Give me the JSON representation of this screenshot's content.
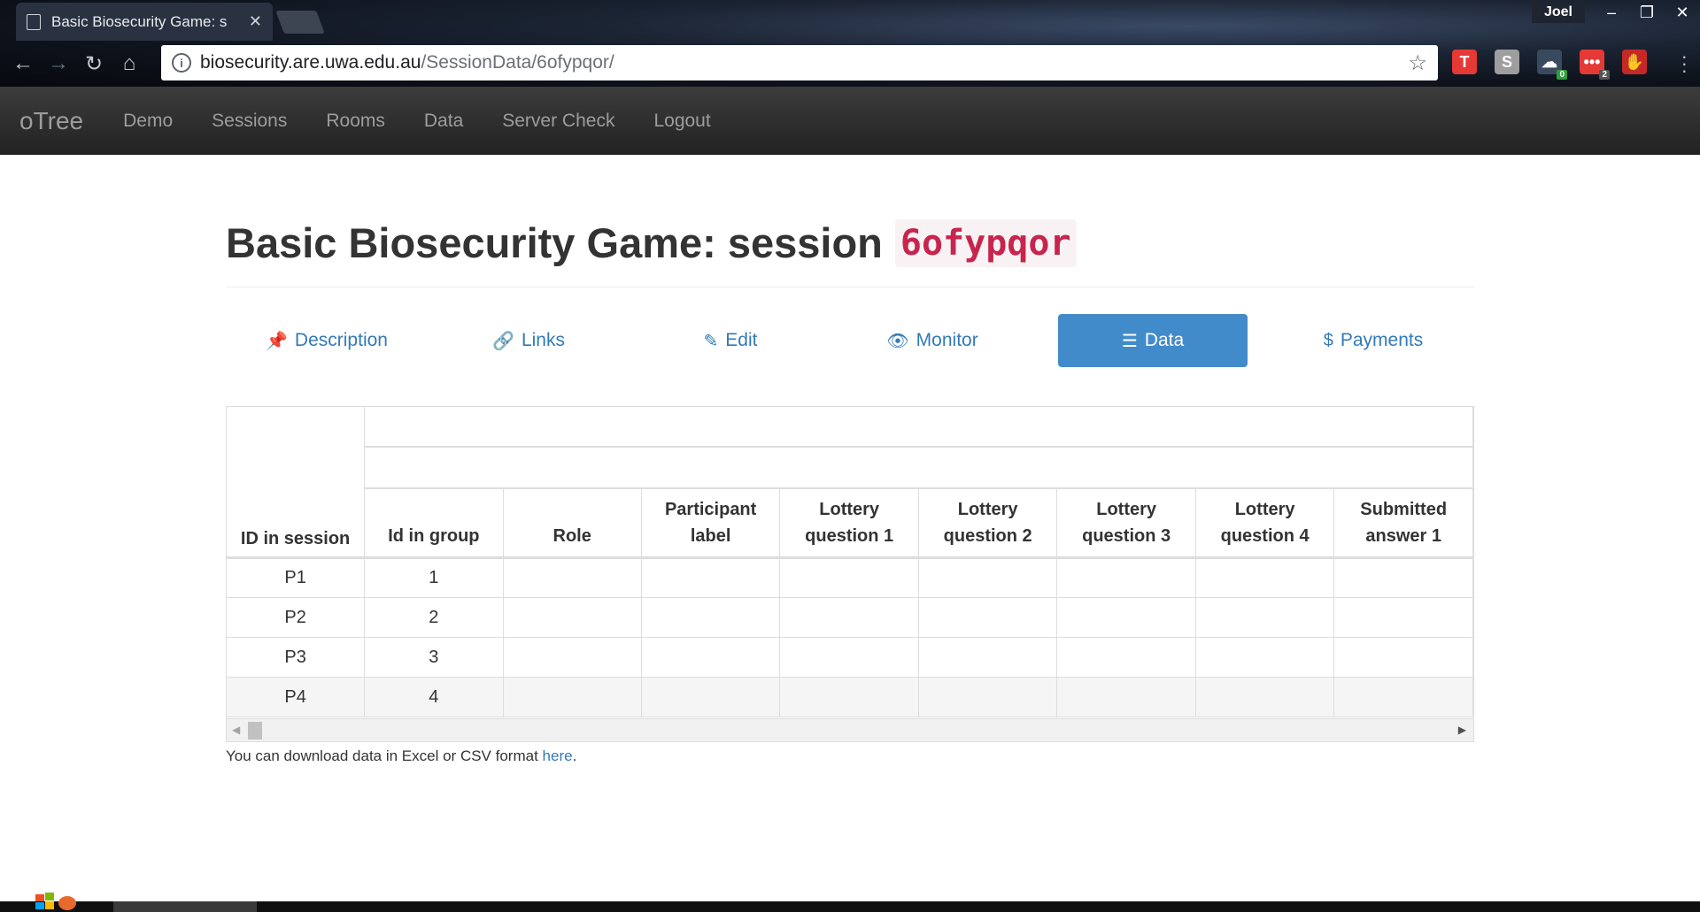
{
  "browser": {
    "tab_title": "Basic Biosecurity Game: s",
    "profile_name": "Joel",
    "url_host": "biosecurity.are.uwa.edu.au",
    "url_path": "/SessionData/6ofypqor/",
    "extensions": [
      {
        "icon": "t-icon",
        "label": "T",
        "color": "#e53935"
      },
      {
        "icon": "s-icon",
        "label": "S",
        "color": "#9e9e9e"
      },
      {
        "icon": "cloud-icon",
        "label": "☁",
        "color": "#3a4a5e",
        "badge": "0",
        "badge_color": "#2e9e3e"
      },
      {
        "icon": "dots-icon",
        "label": "•••",
        "color": "#e53935",
        "badge": "2",
        "badge_color": "#555"
      },
      {
        "icon": "adblock-icon",
        "label": "✋",
        "color": "#c62828"
      }
    ]
  },
  "navbar": {
    "brand": "oTree",
    "links": [
      "Demo",
      "Sessions",
      "Rooms",
      "Data",
      "Server Check",
      "Logout"
    ]
  },
  "page": {
    "title_prefix": "Basic Biosecurity Game: session",
    "session_code": "6ofypqor"
  },
  "pills": [
    {
      "label": "Description",
      "icon": "pushpin-icon",
      "glyph": "📌",
      "active": false
    },
    {
      "label": "Links",
      "icon": "link-icon",
      "glyph": "🔗",
      "active": false
    },
    {
      "label": "Edit",
      "icon": "pencil-icon",
      "glyph": "✎",
      "active": false
    },
    {
      "label": "Monitor",
      "icon": "eye-icon",
      "glyph": "👁",
      "active": false
    },
    {
      "label": "Data",
      "icon": "list-icon",
      "glyph": "☰",
      "active": true
    },
    {
      "label": "Payments",
      "icon": "dollar-icon",
      "glyph": "$",
      "active": false
    }
  ],
  "table": {
    "id_header": "ID in session",
    "headers": [
      "Id in group",
      "Role",
      "Participant label",
      "Lottery question 1",
      "Lottery question 2",
      "Lottery question 3",
      "Lottery question 4",
      "Submitted answer 1"
    ],
    "rows": [
      {
        "id": "P1",
        "group": "1"
      },
      {
        "id": "P2",
        "group": "2"
      },
      {
        "id": "P3",
        "group": "3"
      },
      {
        "id": "P4",
        "group": "4"
      }
    ]
  },
  "download": {
    "text": "You can download data in Excel or CSV format ",
    "link": "here",
    "suffix": "."
  }
}
